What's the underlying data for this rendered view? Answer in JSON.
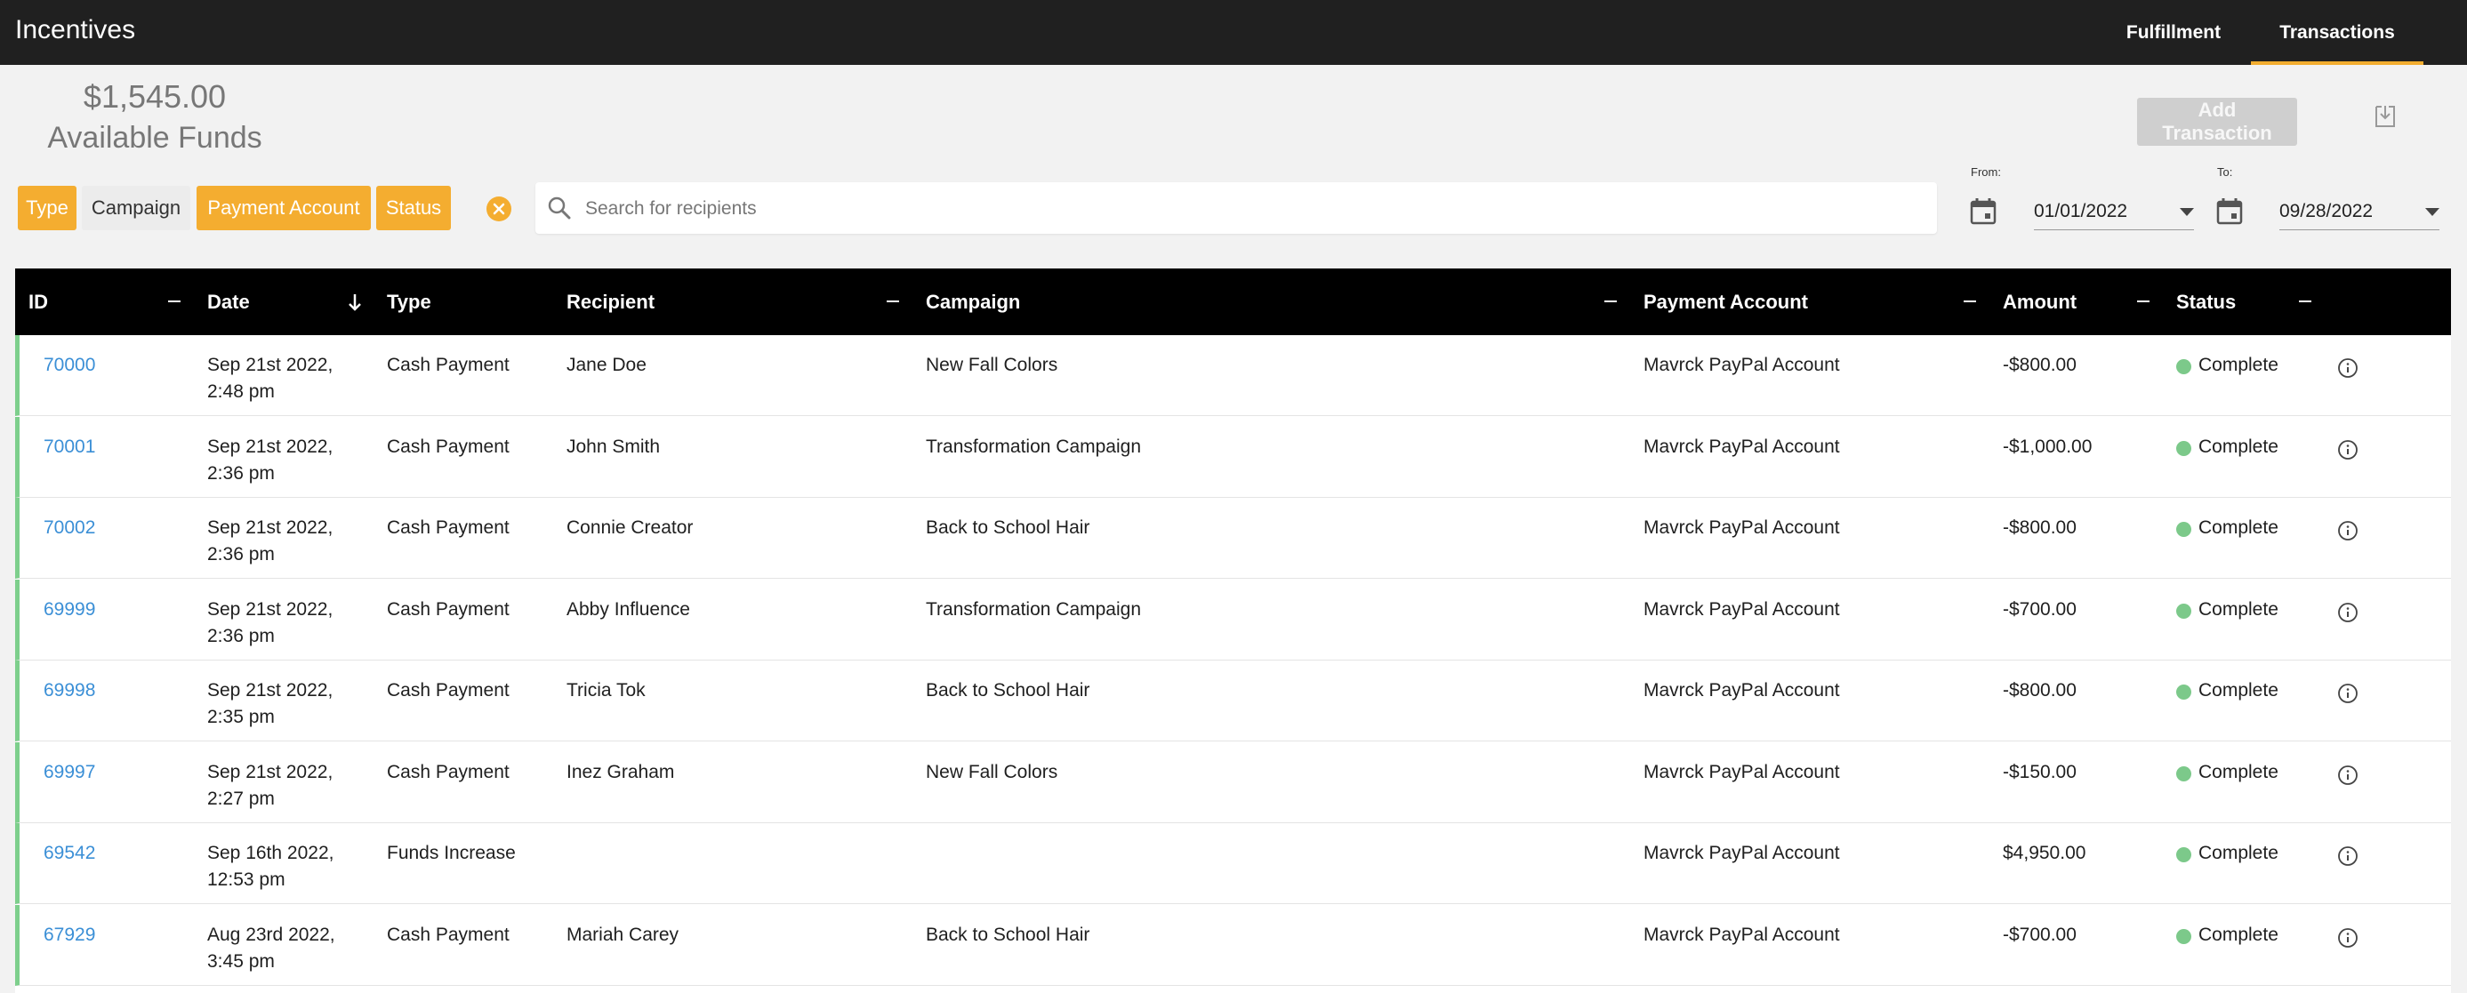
{
  "app": {
    "title": "Incentives"
  },
  "nav": {
    "tabs": [
      {
        "label": "Fulfillment"
      },
      {
        "label": "Transactions",
        "active": true
      }
    ]
  },
  "funds": {
    "amount": "$1,545.00",
    "label": "Available Funds"
  },
  "actions": {
    "add_transaction": "Add Transaction"
  },
  "filters": {
    "chips": [
      {
        "label": "Type",
        "active": true
      },
      {
        "label": "Campaign",
        "active": false
      },
      {
        "label": "Payment Account",
        "active": true
      },
      {
        "label": "Status",
        "active": true
      }
    ]
  },
  "search": {
    "placeholder": "Search for recipients",
    "value": ""
  },
  "date_range": {
    "from_label": "From:",
    "from_value": "01/01/2022",
    "to_label": "To:",
    "to_value": "09/28/2022"
  },
  "table": {
    "columns": [
      "ID",
      "Date",
      "Type",
      "Recipient",
      "Campaign",
      "Payment Account",
      "Amount",
      "Status"
    ],
    "sort": {
      "column": "Date",
      "direction": "desc"
    },
    "rows": [
      {
        "id": "70000",
        "date1": "Sep 21st 2022,",
        "date2": "2:48 pm",
        "type": "Cash Payment",
        "recipient": "Jane Doe",
        "campaign": "New Fall Colors",
        "account": "Mavrck PayPal Account",
        "amount": "-$800.00",
        "status": "Complete"
      },
      {
        "id": "70001",
        "date1": "Sep 21st 2022,",
        "date2": "2:36 pm",
        "type": "Cash Payment",
        "recipient": "John Smith",
        "campaign": "Transformation Campaign",
        "account": "Mavrck PayPal Account",
        "amount": "-$1,000.00",
        "status": "Complete"
      },
      {
        "id": "70002",
        "date1": "Sep 21st 2022,",
        "date2": "2:36 pm",
        "type": "Cash Payment",
        "recipient": "Connie Creator",
        "campaign": "Back to School Hair",
        "account": "Mavrck PayPal Account",
        "amount": "-$800.00",
        "status": "Complete"
      },
      {
        "id": "69999",
        "date1": "Sep 21st 2022,",
        "date2": "2:36 pm",
        "type": "Cash Payment",
        "recipient": "Abby Influence",
        "campaign": "Transformation Campaign",
        "account": "Mavrck PayPal Account",
        "amount": "-$700.00",
        "status": "Complete"
      },
      {
        "id": "69998",
        "date1": "Sep 21st 2022,",
        "date2": "2:35 pm",
        "type": "Cash Payment",
        "recipient": "Tricia Tok",
        "campaign": "Back to School Hair",
        "account": "Mavrck PayPal Account",
        "amount": "-$800.00",
        "status": "Complete"
      },
      {
        "id": "69997",
        "date1": "Sep 21st 2022,",
        "date2": "2:27 pm",
        "type": "Cash Payment",
        "recipient": "Inez Graham",
        "campaign": "New Fall Colors",
        "account": "Mavrck PayPal Account",
        "amount": "-$150.00",
        "status": "Complete"
      },
      {
        "id": "69542",
        "date1": "Sep 16th 2022,",
        "date2": "12:53 pm",
        "type": "Funds Increase",
        "recipient": "",
        "campaign": "",
        "account": "Mavrck PayPal Account",
        "amount": "$4,950.00",
        "status": "Complete"
      },
      {
        "id": "67929",
        "date1": "Aug 23rd 2022,",
        "date2": "3:45 pm",
        "type": "Cash Payment",
        "recipient": "Mariah Carey",
        "campaign": "Back to School Hair",
        "account": "Mavrck PayPal Account",
        "amount": "-$700.00",
        "status": "Complete"
      }
    ]
  },
  "colors": {
    "accent": "#f4ad30",
    "header_bg": "#202020",
    "link": "#3b8fd6",
    "status_complete": "#7cc98a"
  },
  "icons": {
    "search": "search-icon",
    "calendar": "calendar-icon",
    "clear": "clear-filter-icon",
    "download": "download-icon",
    "info": "info-icon",
    "sort": "arrow-down-icon"
  }
}
